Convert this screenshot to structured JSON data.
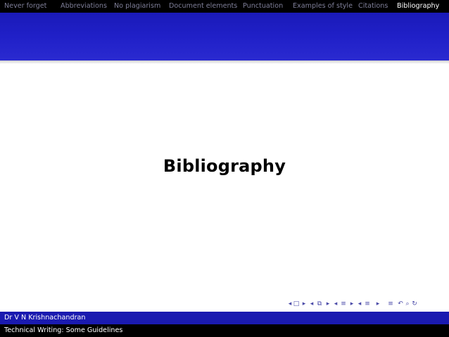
{
  "nav": {
    "items": [
      {
        "label": "Never forget"
      },
      {
        "label": "Abbreviations"
      },
      {
        "label": "No plagiarism"
      },
      {
        "label": "Document elements"
      },
      {
        "label": "Punctuation"
      },
      {
        "label": "Examples of style"
      },
      {
        "label": "Citations"
      },
      {
        "label": "Bibliography"
      }
    ],
    "active": "Bibliography"
  },
  "slide": {
    "title": "Bibliography"
  },
  "footer": {
    "author": "Dr V N Krishnachandran",
    "title": "Technical Writing: Some Guidelines"
  },
  "colors": {
    "nav_bg": "#000000",
    "nav_text": "#7f7f99",
    "nav_active": "#ffffff",
    "band": "#2020c8",
    "footer_author_bg": "#1a1ab0",
    "footer_title_bg": "#000000",
    "nav_symbols": "#4a4aa8"
  },
  "navigation_symbols": [
    "first-frame-icon",
    "prev-frame-icon",
    "next-frame-icon",
    "prev-subsection-icon",
    "next-subsection-icon",
    "prev-section-icon",
    "next-section-icon",
    "back-icon",
    "search-icon",
    "refresh-icon"
  ]
}
